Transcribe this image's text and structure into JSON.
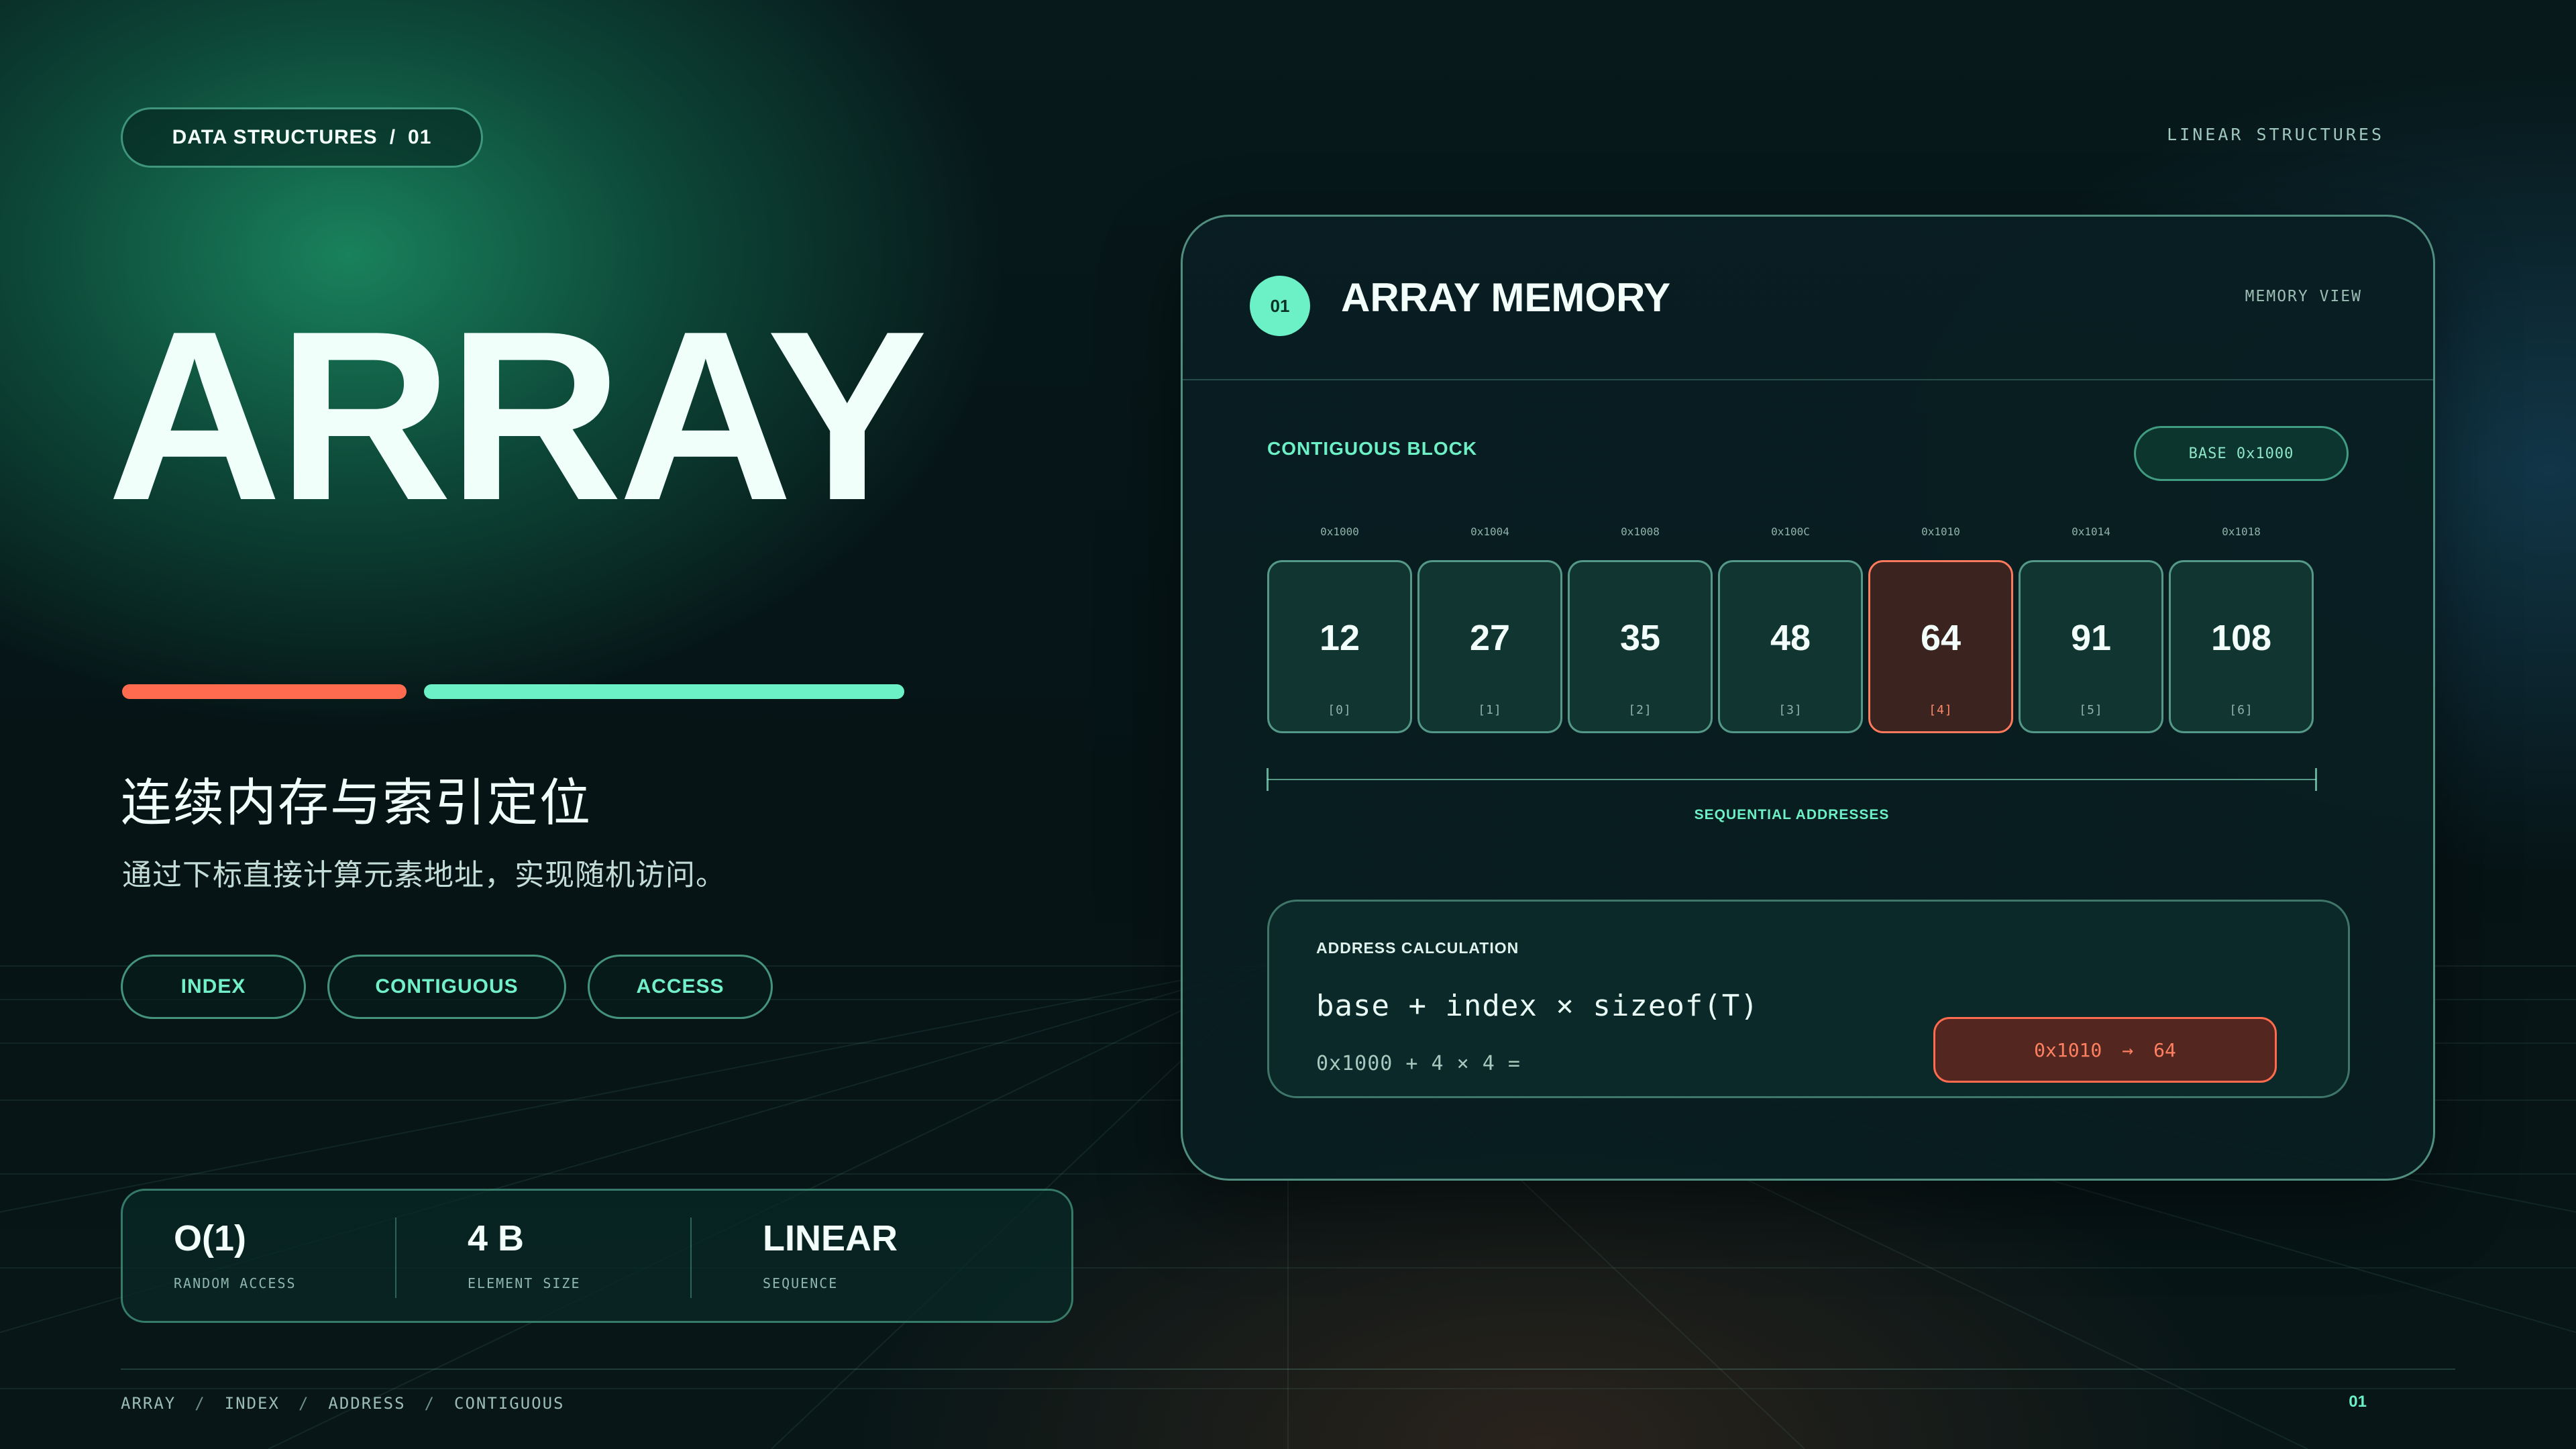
{
  "header": {
    "tag": {
      "label": "DATA STRUCTURES",
      "separator": "/",
      "number": "01"
    },
    "top_right": "LINEAR STRUCTURES"
  },
  "hero": {
    "title": "ARRAY",
    "subtitle": "连续内存与索引定位",
    "description": "通过下标直接计算元素地址，实现随机访问。"
  },
  "accent_colors": {
    "orange": "#ff6b4f",
    "mint": "#6cf0c6"
  },
  "chips": [
    "INDEX",
    "CONTIGUOUS",
    "ACCESS"
  ],
  "stats": [
    {
      "value": "O(1)",
      "label": "RANDOM ACCESS"
    },
    {
      "value": "4 B",
      "label": "ELEMENT SIZE"
    },
    {
      "value": "LINEAR",
      "label": "SEQUENCE"
    }
  ],
  "card": {
    "badge": "01",
    "title": "ARRAY MEMORY",
    "tag": "MEMORY VIEW",
    "block_label": "CONTIGUOUS BLOCK",
    "base": "BASE 0x1000",
    "cells": [
      {
        "address": "0x1000",
        "value": "12",
        "index": "[0]"
      },
      {
        "address": "0x1004",
        "value": "27",
        "index": "[1]"
      },
      {
        "address": "0x1008",
        "value": "35",
        "index": "[2]"
      },
      {
        "address": "0x100C",
        "value": "48",
        "index": "[3]"
      },
      {
        "address": "0x1010",
        "value": "64",
        "index": "[4]",
        "highlighted": true
      },
      {
        "address": "0x1014",
        "value": "91",
        "index": "[5]"
      },
      {
        "address": "0x1018",
        "value": "108",
        "index": "[6]"
      }
    ],
    "sequence_label": "SEQUENTIAL ADDRESSES",
    "calc": {
      "label": "ADDRESS CALCULATION",
      "formula": "base + index × sizeof(T)",
      "expression": "0x1000 + 4 × 4 =",
      "result_address": "0x1010",
      "result_arrow": "→",
      "result_value": "64"
    }
  },
  "footer": {
    "crumbs": [
      "ARRAY",
      "INDEX",
      "ADDRESS",
      "CONTIGUOUS"
    ],
    "separator": "/",
    "page": "01"
  }
}
